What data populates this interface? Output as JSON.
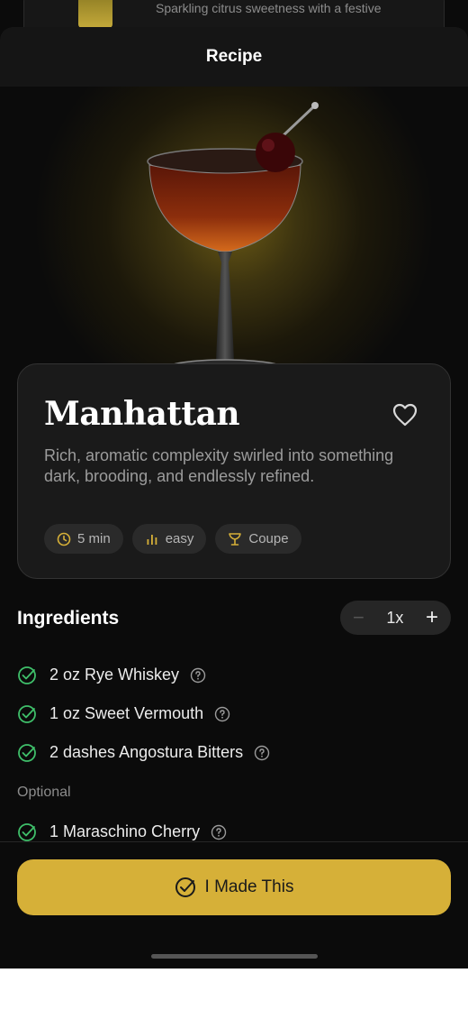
{
  "behind_card": {
    "text": "Sparkling citrus sweetness with a festive"
  },
  "header": {
    "title": "Recipe"
  },
  "recipe": {
    "name": "Manhattan",
    "description": "Rich, aromatic complexity swirled into something dark, brooding, and endlessly refined.",
    "chips": [
      {
        "icon": "clock-icon",
        "label": "5 min"
      },
      {
        "icon": "bar-chart-icon",
        "label": "easy"
      },
      {
        "icon": "coupe-glass-icon",
        "label": "Coupe"
      }
    ]
  },
  "ingredients": {
    "title": "Ingredients",
    "multiplier": "1x",
    "minus": "−",
    "plus": "+",
    "items": [
      {
        "text": "2 oz Rye Whiskey"
      },
      {
        "text": "1 oz Sweet Vermouth"
      },
      {
        "text": "2 dashes Angostura Bitters"
      }
    ],
    "optional_label": "Optional",
    "optional_items": [
      {
        "text": "1 Maraschino Cherry"
      }
    ]
  },
  "actions": {
    "made_this": "I Made This"
  },
  "colors": {
    "accent": "#d6b038",
    "check": "#3fbf6a",
    "background": "#0b0b0b"
  }
}
